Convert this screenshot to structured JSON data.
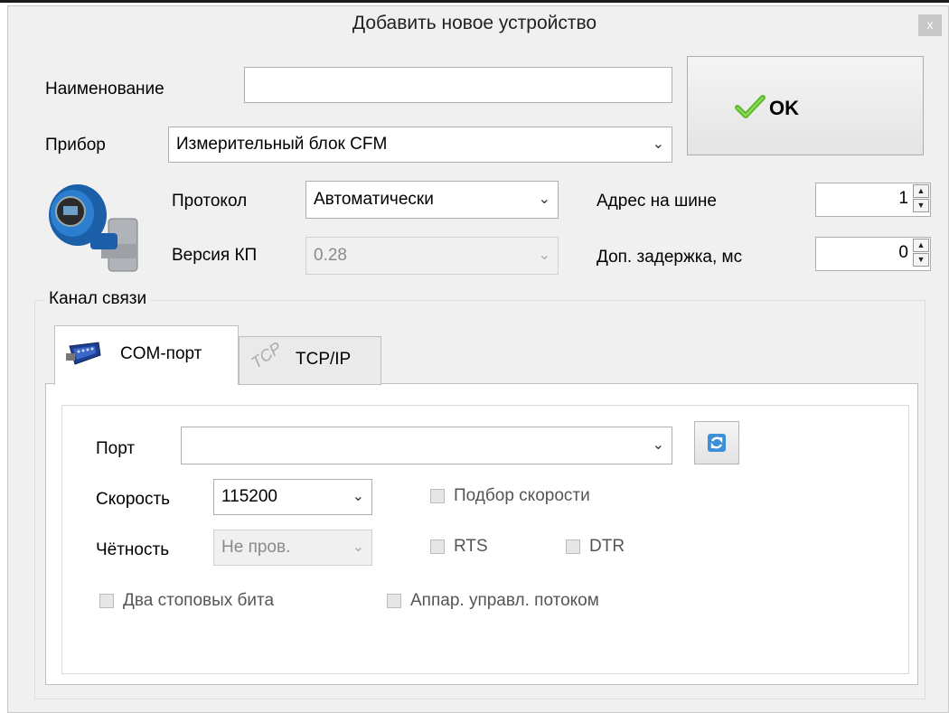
{
  "window": {
    "title": "Добавить новое устройство",
    "close_label": "x"
  },
  "form": {
    "name_label": "Наименование",
    "name_value": "",
    "device_label": "Прибор",
    "device_value": "Измерительный блок CFM",
    "protocol_label": "Протокол",
    "protocol_value": "Автоматически",
    "version_label": "Версия КП",
    "version_value": "0.28",
    "bus_address_label": "Адрес на шине",
    "bus_address_value": "1",
    "delay_label": "Доп. задержка, мс",
    "delay_value": "0",
    "ok_label": "OK"
  },
  "channel": {
    "group_label": "Канал связи",
    "tabs": [
      {
        "label": "COM-порт",
        "icon": "serial-port-icon",
        "active": true
      },
      {
        "label": "TCP/IP",
        "icon": "tcp-icon",
        "active": false
      }
    ],
    "tcp_icon_text": "TCP",
    "com": {
      "port_label": "Порт",
      "port_value": "",
      "speed_label": "Скорость",
      "speed_value": "115200",
      "auto_speed_label": "Подбор скорости",
      "parity_label": "Чётность",
      "parity_value": "Не пров.",
      "rts_label": "RTS",
      "dtr_label": "DTR",
      "two_stop_bits_label": "Два стоповых бита",
      "flow_control_label": "Аппар. управл. потоком"
    }
  },
  "colors": {
    "window_bg": "#f0f0f0",
    "ok_check": "#5cb82a",
    "device_blue": "#1a5fa8"
  }
}
